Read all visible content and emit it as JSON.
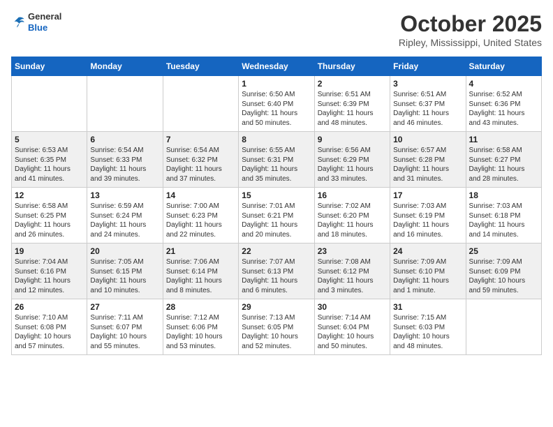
{
  "header": {
    "logo_line1": "General",
    "logo_line2": "Blue",
    "month": "October 2025",
    "location": "Ripley, Mississippi, United States"
  },
  "weekdays": [
    "Sunday",
    "Monday",
    "Tuesday",
    "Wednesday",
    "Thursday",
    "Friday",
    "Saturday"
  ],
  "weeks": [
    [
      {
        "day": "",
        "info": ""
      },
      {
        "day": "",
        "info": ""
      },
      {
        "day": "",
        "info": ""
      },
      {
        "day": "1",
        "info": "Sunrise: 6:50 AM\nSunset: 6:40 PM\nDaylight: 11 hours\nand 50 minutes."
      },
      {
        "day": "2",
        "info": "Sunrise: 6:51 AM\nSunset: 6:39 PM\nDaylight: 11 hours\nand 48 minutes."
      },
      {
        "day": "3",
        "info": "Sunrise: 6:51 AM\nSunset: 6:37 PM\nDaylight: 11 hours\nand 46 minutes."
      },
      {
        "day": "4",
        "info": "Sunrise: 6:52 AM\nSunset: 6:36 PM\nDaylight: 11 hours\nand 43 minutes."
      }
    ],
    [
      {
        "day": "5",
        "info": "Sunrise: 6:53 AM\nSunset: 6:35 PM\nDaylight: 11 hours\nand 41 minutes."
      },
      {
        "day": "6",
        "info": "Sunrise: 6:54 AM\nSunset: 6:33 PM\nDaylight: 11 hours\nand 39 minutes."
      },
      {
        "day": "7",
        "info": "Sunrise: 6:54 AM\nSunset: 6:32 PM\nDaylight: 11 hours\nand 37 minutes."
      },
      {
        "day": "8",
        "info": "Sunrise: 6:55 AM\nSunset: 6:31 PM\nDaylight: 11 hours\nand 35 minutes."
      },
      {
        "day": "9",
        "info": "Sunrise: 6:56 AM\nSunset: 6:29 PM\nDaylight: 11 hours\nand 33 minutes."
      },
      {
        "day": "10",
        "info": "Sunrise: 6:57 AM\nSunset: 6:28 PM\nDaylight: 11 hours\nand 31 minutes."
      },
      {
        "day": "11",
        "info": "Sunrise: 6:58 AM\nSunset: 6:27 PM\nDaylight: 11 hours\nand 28 minutes."
      }
    ],
    [
      {
        "day": "12",
        "info": "Sunrise: 6:58 AM\nSunset: 6:25 PM\nDaylight: 11 hours\nand 26 minutes."
      },
      {
        "day": "13",
        "info": "Sunrise: 6:59 AM\nSunset: 6:24 PM\nDaylight: 11 hours\nand 24 minutes."
      },
      {
        "day": "14",
        "info": "Sunrise: 7:00 AM\nSunset: 6:23 PM\nDaylight: 11 hours\nand 22 minutes."
      },
      {
        "day": "15",
        "info": "Sunrise: 7:01 AM\nSunset: 6:21 PM\nDaylight: 11 hours\nand 20 minutes."
      },
      {
        "day": "16",
        "info": "Sunrise: 7:02 AM\nSunset: 6:20 PM\nDaylight: 11 hours\nand 18 minutes."
      },
      {
        "day": "17",
        "info": "Sunrise: 7:03 AM\nSunset: 6:19 PM\nDaylight: 11 hours\nand 16 minutes."
      },
      {
        "day": "18",
        "info": "Sunrise: 7:03 AM\nSunset: 6:18 PM\nDaylight: 11 hours\nand 14 minutes."
      }
    ],
    [
      {
        "day": "19",
        "info": "Sunrise: 7:04 AM\nSunset: 6:16 PM\nDaylight: 11 hours\nand 12 minutes."
      },
      {
        "day": "20",
        "info": "Sunrise: 7:05 AM\nSunset: 6:15 PM\nDaylight: 11 hours\nand 10 minutes."
      },
      {
        "day": "21",
        "info": "Sunrise: 7:06 AM\nSunset: 6:14 PM\nDaylight: 11 hours\nand 8 minutes."
      },
      {
        "day": "22",
        "info": "Sunrise: 7:07 AM\nSunset: 6:13 PM\nDaylight: 11 hours\nand 6 minutes."
      },
      {
        "day": "23",
        "info": "Sunrise: 7:08 AM\nSunset: 6:12 PM\nDaylight: 11 hours\nand 3 minutes."
      },
      {
        "day": "24",
        "info": "Sunrise: 7:09 AM\nSunset: 6:10 PM\nDaylight: 11 hours\nand 1 minute."
      },
      {
        "day": "25",
        "info": "Sunrise: 7:09 AM\nSunset: 6:09 PM\nDaylight: 10 hours\nand 59 minutes."
      }
    ],
    [
      {
        "day": "26",
        "info": "Sunrise: 7:10 AM\nSunset: 6:08 PM\nDaylight: 10 hours\nand 57 minutes."
      },
      {
        "day": "27",
        "info": "Sunrise: 7:11 AM\nSunset: 6:07 PM\nDaylight: 10 hours\nand 55 minutes."
      },
      {
        "day": "28",
        "info": "Sunrise: 7:12 AM\nSunset: 6:06 PM\nDaylight: 10 hours\nand 53 minutes."
      },
      {
        "day": "29",
        "info": "Sunrise: 7:13 AM\nSunset: 6:05 PM\nDaylight: 10 hours\nand 52 minutes."
      },
      {
        "day": "30",
        "info": "Sunrise: 7:14 AM\nSunset: 6:04 PM\nDaylight: 10 hours\nand 50 minutes."
      },
      {
        "day": "31",
        "info": "Sunrise: 7:15 AM\nSunset: 6:03 PM\nDaylight: 10 hours\nand 48 minutes."
      },
      {
        "day": "",
        "info": ""
      }
    ]
  ]
}
